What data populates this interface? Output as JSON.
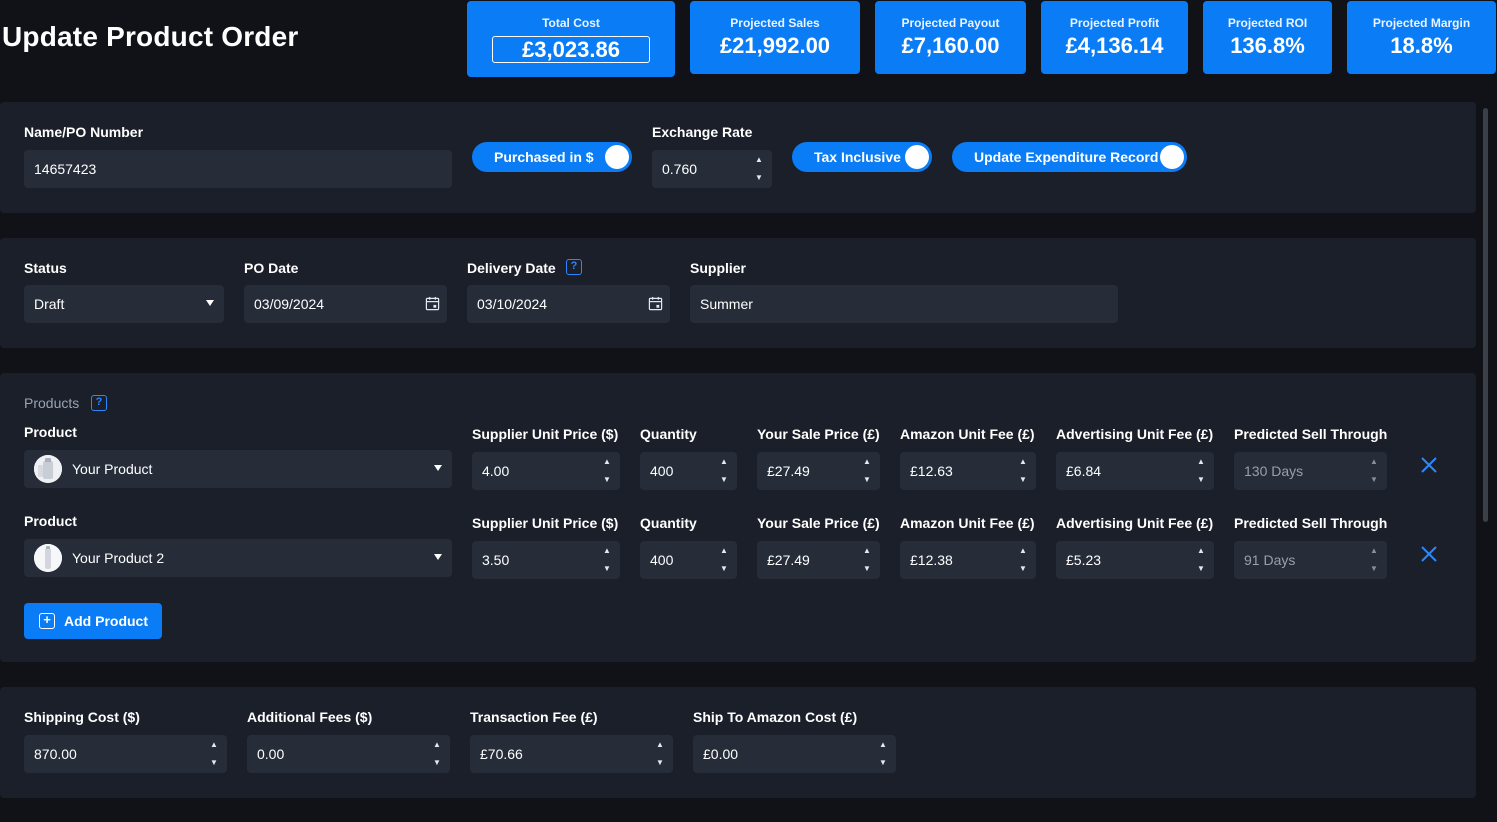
{
  "page": {
    "title": "Update Product Order"
  },
  "kpis": {
    "total_cost": {
      "label": "Total Cost",
      "value": "£3,023.86"
    },
    "projected_sales": {
      "label": "Projected Sales",
      "value": "£21,992.00"
    },
    "projected_payout": {
      "label": "Projected Payout",
      "value": "£7,160.00"
    },
    "projected_profit": {
      "label": "Projected Profit",
      "value": "£4,136.14"
    },
    "projected_roi": {
      "label": "Projected ROI",
      "value": "136.8%"
    },
    "projected_margin": {
      "label": "Projected Margin",
      "value": "18.8%"
    }
  },
  "order": {
    "name_label": "Name/PO Number",
    "name_value": "14657423",
    "purchased_toggle": "Purchased in $",
    "exchange_rate_label": "Exchange Rate",
    "exchange_rate_value": "0.760",
    "tax_toggle": "Tax Inclusive",
    "expenditure_toggle": "Update Expenditure Record"
  },
  "details": {
    "status_label": "Status",
    "status_value": "Draft",
    "po_date_label": "PO Date",
    "po_date_value": "03/09/2024",
    "delivery_date_label": "Delivery Date",
    "delivery_date_value": "03/10/2024",
    "supplier_label": "Supplier",
    "supplier_value": "Summer",
    "help_glyph": "?"
  },
  "products": {
    "caption": "Products",
    "help_glyph": "?",
    "columns": {
      "product": "Product",
      "supplier_unit_price": "Supplier Unit Price ($)",
      "quantity": "Quantity",
      "sale_price": "Your Sale Price (£)",
      "amazon_fee": "Amazon Unit Fee (£)",
      "advertising_fee": "Advertising Unit Fee (£)",
      "sell_through": "Predicted Sell Through"
    },
    "rows": [
      {
        "product": "Your Product",
        "supplier_unit_price": "4.00",
        "quantity": "400",
        "sale_price": "£27.49",
        "amazon_fee": "£12.63",
        "advertising_fee": "£6.84",
        "sell_through": "130 Days"
      },
      {
        "product": "Your Product 2",
        "supplier_unit_price": "3.50",
        "quantity": "400",
        "sale_price": "£27.49",
        "amazon_fee": "£12.38",
        "advertising_fee": "£5.23",
        "sell_through": "91 Days"
      }
    ],
    "add_button": "Add Product"
  },
  "costs": {
    "shipping_label": "Shipping Cost ($)",
    "shipping_value": "870.00",
    "additional_label": "Additional Fees ($)",
    "additional_value": "0.00",
    "transaction_label": "Transaction Fee (£)",
    "transaction_value": "£70.66",
    "ship_amazon_label": "Ship To Amazon Cost (£)",
    "ship_amazon_value": "£0.00"
  },
  "icons": {
    "spinner": "spinner-icon",
    "calendar": "calendar-icon",
    "remove": "close-icon",
    "help": "help-icon",
    "add": "plus-icon"
  },
  "colors": {
    "accent": "#0a7cf5",
    "background": "#101218",
    "card": "#1a1f29",
    "input": "#262c38"
  }
}
